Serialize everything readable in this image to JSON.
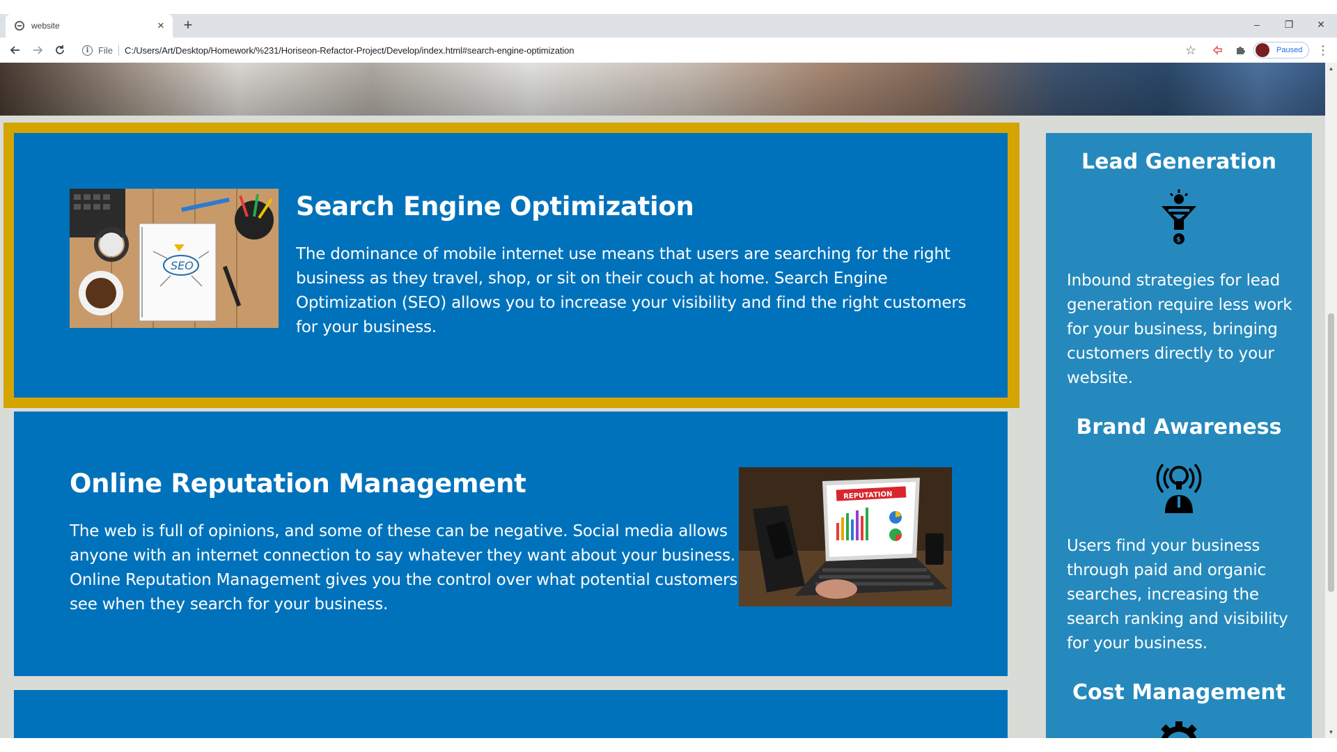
{
  "browser": {
    "tab_title": "website",
    "tab_close": "×",
    "new_tab": "+",
    "window_minimize": "–",
    "window_restore": "❐",
    "window_close": "✕",
    "scheme": "File",
    "url": "C:/Users/Art/Desktop/Homework/%231/Horiseon-Refactor-Project/Develop/index.html#search-engine-optimization",
    "profile_status": "Paused",
    "icons": {
      "back": "back-arrow-icon",
      "forward": "forward-arrow-icon",
      "reload": "reload-icon",
      "info": "info-icon",
      "star": "bookmark-star-icon",
      "extension1": "extension-icon",
      "extensions": "puzzle-icon",
      "menu": "kebab-menu-icon"
    }
  },
  "content": {
    "seo": {
      "title": "Search Engine Optimization",
      "body": "The dominance of mobile internet use means that users are searching for the right business as they travel, shop, or sit on their couch at home. Search Engine Optimization (SEO) allows you to increase your visibility and find the right customers for your business.",
      "image": "seo-notebook-image"
    },
    "orm": {
      "title": "Online Reputation Management",
      "body": "The web is full of opinions, and some of these can be negative. Social media allows anyone with an internet connection to say whatever they want about your business. Online Reputation Management gives you the control over what potential customers see when they search for your business.",
      "image": "reputation-laptop-image",
      "image_label": "REPUTATION"
    }
  },
  "sidebar": {
    "items": [
      {
        "title": "Lead Generation",
        "icon": "lead-funnel-icon",
        "body": "Inbound strategies for lead generation require less work for your business, bringing customers directly to your website."
      },
      {
        "title": "Brand Awareness",
        "icon": "broadcast-person-icon",
        "body": "Users find your business through paid and organic searches, increasing the search ranking and visibility for your business."
      },
      {
        "title": "Cost Management",
        "icon": "gear-icon",
        "body": ""
      }
    ]
  },
  "colors": {
    "card_blue": "#0072bb",
    "sidebar_blue": "#2589bd",
    "highlight_gold": "#d4a500",
    "page_bg": "#d9dcd6"
  }
}
